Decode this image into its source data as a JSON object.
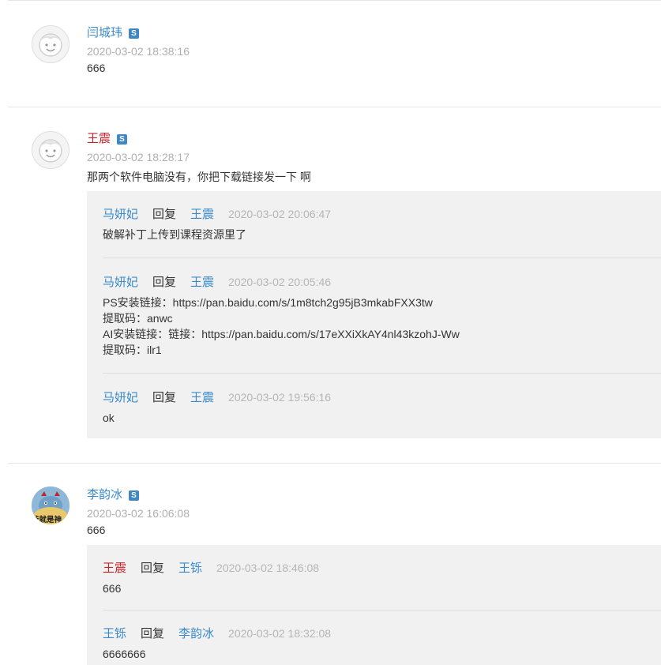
{
  "colors": {
    "link": "#3a8ac9",
    "highlight_name": "#c0272d",
    "timestamp": "#b0b0b0",
    "reply_bg": "#f1f1f1",
    "badge": "#3f88c4"
  },
  "comments": [
    {
      "author": "闫城玮",
      "badge": "S",
      "time": "2020-03-02 18:38:16",
      "text": "666",
      "avatar_icon": "default-face-icon"
    },
    {
      "author": "王震",
      "badge": "S",
      "time": "2020-03-02 18:28:17",
      "text": "那两个软件电脑没有，你把下载链接发一下 啊",
      "avatar_icon": "default-face-icon",
      "replies": [
        {
          "from": "马妍妃",
          "action": "回复",
          "to": "王震",
          "time": "2020-03-02 20:06:47",
          "lines": [
            "破解补丁上传到课程资源里了"
          ]
        },
        {
          "from": "马妍妃",
          "action": "回复",
          "to": "王震",
          "time": "2020-03-02 20:05:46",
          "lines": [
            "PS安装链接：https://pan.baidu.com/s/1m8tch2g95jB3mkabFXX3tw",
            "提取码：anwc",
            "AI安装链接：链接：https://pan.baidu.com/s/17eXXiXkAY4nl43kzohJ-Ww",
            "提取码：ilr1"
          ]
        },
        {
          "from": "马妍妃",
          "action": "回复",
          "to": "王震",
          "time": "2020-03-02 19:56:16",
          "lines": [
            "ok"
          ]
        }
      ]
    },
    {
      "author": "李韵冰",
      "badge": "S",
      "time": "2020-03-02 16:06:08",
      "text": "666",
      "avatar_icon": "cartoon-avatar-icon",
      "avatar_text": "爷就是神",
      "replies": [
        {
          "from": "王震",
          "action": "回复",
          "to": "王铄",
          "time": "2020-03-02 18:46:08",
          "lines": [
            "666"
          ]
        },
        {
          "from": "王铄",
          "action": "回复",
          "to": "李韵冰",
          "time": "2020-03-02 18:32:08",
          "lines": [
            "6666666"
          ]
        }
      ]
    }
  ]
}
